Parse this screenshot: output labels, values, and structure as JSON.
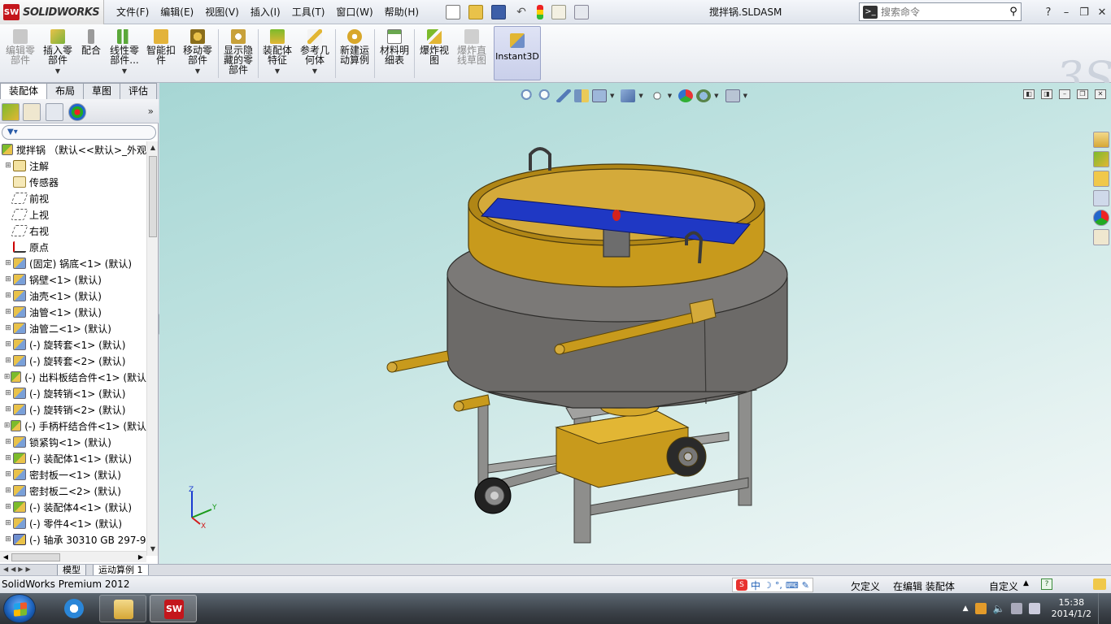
{
  "app": {
    "logo_text": "SOLIDWORKS",
    "menu": [
      "文件(F)",
      "编辑(E)",
      "视图(V)",
      "插入(I)",
      "工具(T)",
      "窗口(W)",
      "帮助(H)"
    ],
    "document_title": "搅拌锅.SLDASM",
    "search": {
      "placeholder": "搜索命令"
    },
    "window_controls": [
      "?",
      "–",
      "❐",
      "✕"
    ]
  },
  "commands": [
    {
      "label": "编辑零\n部件",
      "disabled": true,
      "has_arrow": false
    },
    {
      "label": "插入零\n部件",
      "disabled": false,
      "has_arrow": true
    },
    {
      "label": "配合",
      "disabled": false,
      "has_arrow": false
    },
    {
      "label": "线性零\n部件...",
      "disabled": false,
      "has_arrow": true
    },
    {
      "label": "智能扣\n件",
      "disabled": false,
      "has_arrow": false
    },
    {
      "label": "移动零\n部件",
      "disabled": false,
      "has_arrow": true
    },
    {
      "label": "显示隐\n藏的零\n部件",
      "disabled": false,
      "has_arrow": false
    },
    {
      "label": "装配体\n特征",
      "disabled": false,
      "has_arrow": true
    },
    {
      "label": "参考几\n何体",
      "disabled": false,
      "has_arrow": true
    },
    {
      "label": "新建运\n动算例",
      "disabled": false,
      "has_arrow": false
    },
    {
      "label": "材料明\n细表",
      "disabled": false,
      "has_arrow": false
    },
    {
      "label": "爆炸视\n图",
      "disabled": false,
      "has_arrow": false
    },
    {
      "label": "爆炸直\n线草图",
      "disabled": true,
      "has_arrow": false
    }
  ],
  "instant3d_label": "Instant3D",
  "tabs": [
    "装配体",
    "布局",
    "草图",
    "评估"
  ],
  "active_tab": 0,
  "tree": {
    "root": "搅拌锅 （默认<<默认>_外观",
    "items": [
      {
        "label": "注解",
        "icon": "annotation-icon"
      },
      {
        "label": "传感器",
        "icon": "sensor-icon"
      },
      {
        "label": "前视",
        "icon": "plane-icon"
      },
      {
        "label": "上视",
        "icon": "plane-icon"
      },
      {
        "label": "右视",
        "icon": "plane-icon"
      },
      {
        "label": "原点",
        "icon": "origin-icon"
      },
      {
        "label": "(固定) 锅底<1> (默认)",
        "icon": "part-icon"
      },
      {
        "label": "锅壁<1> (默认)",
        "icon": "part-icon"
      },
      {
        "label": "油壳<1> (默认)",
        "icon": "part-icon"
      },
      {
        "label": "油管<1> (默认)",
        "icon": "part-icon"
      },
      {
        "label": "油管二<1> (默认)",
        "icon": "part-icon"
      },
      {
        "label": "(-) 旋转套<1> (默认)",
        "icon": "part-icon"
      },
      {
        "label": "(-) 旋转套<2> (默认)",
        "icon": "part-icon"
      },
      {
        "label": "(-) 出料板结合件<1> (默认",
        "icon": "subassembly-icon"
      },
      {
        "label": "(-) 旋转销<1> (默认)",
        "icon": "part-icon"
      },
      {
        "label": "(-) 旋转销<2> (默认)",
        "icon": "part-icon"
      },
      {
        "label": "(-) 手柄杆结合件<1> (默认",
        "icon": "subassembly-icon"
      },
      {
        "label": "锁紧钩<1> (默认)",
        "icon": "part-icon"
      },
      {
        "label": "(-) 装配体1<1> (默认)",
        "icon": "subassembly-icon"
      },
      {
        "label": "密封板一<1> (默认)",
        "icon": "part-icon"
      },
      {
        "label": "密封板二<2> (默认)",
        "icon": "part-icon"
      },
      {
        "label": "(-) 装配体4<1> (默认)",
        "icon": "subassembly-icon"
      },
      {
        "label": "(-) 零件4<1> (默认)",
        "icon": "part-icon"
      },
      {
        "label": "(-) 轴承 30310 GB 297-9",
        "icon": "toolbox-part-icon"
      }
    ]
  },
  "bottom_tabs": [
    "模型",
    "运动算例 1"
  ],
  "triad": {
    "z": "Z",
    "y": "Y",
    "x": "X"
  },
  "status": {
    "product": "SolidWorks Premium 2012",
    "ime_s": "S",
    "ime_lang": "中",
    "underdefined": "欠定义",
    "editing": "在编辑 装配体",
    "custom": "自定义"
  },
  "taskbar": {
    "time": "15:38",
    "date": "2014/1/2"
  },
  "colors": {
    "viewport_top": "#a6d6d4",
    "body_gray": "#6c6a68",
    "brass": "#c89a1c",
    "blade_blue": "#1f38c4",
    "frame_gray": "#8e8e8c"
  }
}
